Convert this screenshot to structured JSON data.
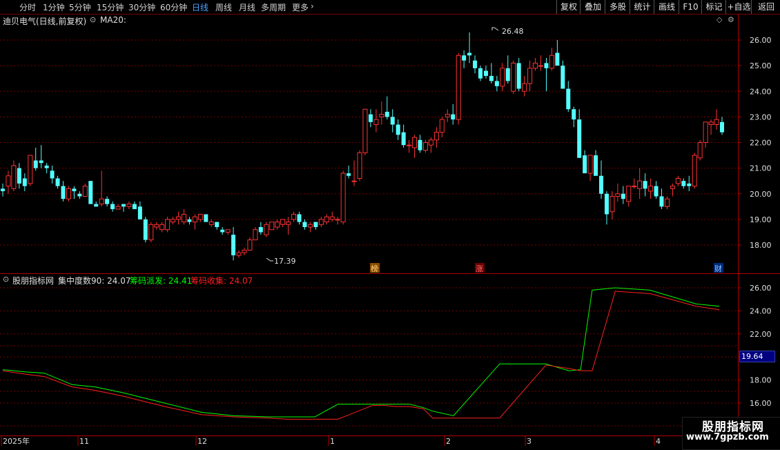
{
  "toolbar": {
    "periods": [
      "分时",
      "1分钟",
      "5分钟",
      "15分钟",
      "30分钟",
      "60分钟",
      "日线",
      "周线",
      "月线",
      "多周期",
      "更多"
    ],
    "active": "日线",
    "right_buttons": [
      "复权",
      "叠加",
      "多股",
      "统计",
      "画线",
      "F10",
      "标记",
      "+自选",
      "返回"
    ]
  },
  "main_header": {
    "stock": "迪贝电气(日线,前复权)",
    "ma": "MA20:"
  },
  "annotations": {
    "high": "26.48",
    "low": "17.39",
    "tag1": "榜",
    "tag2": "涨",
    "tag3": "财"
  },
  "indicator_header": {
    "name": "股朋指标网",
    "item1": "集中度数90: 24.07",
    "item2": "筹码派发: 24.41",
    "item3": "筹码收集: 24.07"
  },
  "value_box": "19.64",
  "time_axis": [
    "2025年",
    "11",
    "12",
    "1",
    "2",
    "3",
    "4"
  ],
  "watermark": {
    "line1": "股朋指标网",
    "line2": "www.7gpzb.com"
  },
  "colors": {
    "up": "#ff3333",
    "down": "#54ffff",
    "grid": "#7a0000",
    "green": "#00ff00",
    "red": "#ff2020"
  },
  "chart_data": [
    {
      "type": "candlestick",
      "price_ticks": [
        "26.00",
        "25.00",
        "24.00",
        "23.00",
        "22.00",
        "21.00",
        "20.00",
        "19.00",
        "18.00"
      ],
      "ylim": [
        17.0,
        26.8
      ],
      "candles": [
        [
          20.2,
          20.4,
          19.9,
          20.1
        ],
        [
          20.3,
          20.9,
          20.0,
          20.7
        ],
        [
          20.2,
          21.3,
          20.1,
          21.1
        ],
        [
          21.0,
          21.2,
          20.2,
          20.4
        ],
        [
          20.6,
          20.8,
          20.1,
          20.3
        ],
        [
          20.4,
          21.5,
          20.3,
          21.5
        ],
        [
          21.3,
          21.8,
          20.9,
          21.0
        ],
        [
          21.3,
          21.9,
          21.0,
          21.2
        ],
        [
          21.1,
          21.2,
          20.8,
          21.0
        ],
        [
          20.9,
          21.1,
          20.4,
          20.6
        ],
        [
          20.6,
          20.7,
          20.2,
          20.3
        ],
        [
          20.3,
          20.5,
          19.7,
          19.8
        ],
        [
          19.8,
          20.3,
          19.7,
          20.2
        ],
        [
          20.2,
          20.3,
          19.8,
          20.1
        ],
        [
          20.0,
          20.1,
          19.8,
          19.9
        ],
        [
          19.9,
          20.4,
          19.9,
          20.3
        ],
        [
          20.5,
          20.5,
          19.6,
          19.6
        ],
        [
          19.6,
          19.7,
          19.5,
          19.5
        ],
        [
          19.6,
          20.9,
          19.5,
          19.8
        ],
        [
          19.8,
          19.9,
          19.5,
          19.6
        ],
        [
          19.6,
          19.7,
          19.3,
          19.4
        ],
        [
          19.4,
          19.6,
          19.4,
          19.5
        ],
        [
          19.6,
          19.6,
          19.3,
          19.5
        ],
        [
          19.5,
          19.7,
          19.4,
          19.6
        ],
        [
          19.6,
          19.7,
          19.4,
          19.4
        ],
        [
          19.5,
          19.7,
          19.3,
          19.0
        ],
        [
          19.0,
          19.1,
          18.1,
          18.2
        ],
        [
          18.2,
          18.9,
          18.1,
          18.8
        ],
        [
          18.7,
          18.9,
          18.6,
          18.8
        ],
        [
          18.6,
          18.9,
          18.5,
          18.8
        ],
        [
          18.6,
          19.1,
          18.5,
          19.0
        ],
        [
          18.9,
          19.1,
          18.8,
          19.0
        ],
        [
          19.0,
          19.3,
          18.8,
          19.1
        ],
        [
          18.9,
          19.4,
          18.8,
          19.2
        ],
        [
          19.0,
          19.1,
          18.8,
          18.9
        ],
        [
          18.9,
          19.2,
          18.6,
          19.1
        ],
        [
          19.0,
          19.2,
          18.9,
          19.2
        ],
        [
          19.2,
          19.2,
          18.9,
          18.9
        ],
        [
          18.8,
          19.0,
          18.7,
          18.9
        ],
        [
          18.9,
          18.9,
          18.6,
          18.7
        ],
        [
          18.6,
          18.7,
          18.4,
          18.5
        ],
        [
          18.5,
          18.6,
          18.4,
          18.6
        ],
        [
          18.4,
          18.7,
          17.4,
          17.6
        ],
        [
          17.6,
          17.8,
          17.5,
          17.7
        ],
        [
          17.7,
          17.9,
          17.6,
          17.8
        ],
        [
          17.8,
          18.3,
          17.8,
          18.2
        ],
        [
          18.2,
          18.7,
          18.2,
          18.6
        ],
        [
          18.7,
          18.9,
          18.4,
          18.5
        ],
        [
          18.4,
          18.9,
          18.3,
          18.8
        ],
        [
          18.6,
          18.9,
          18.6,
          18.9
        ],
        [
          18.7,
          19.0,
          18.6,
          18.9
        ],
        [
          18.8,
          19.0,
          18.7,
          19.0
        ],
        [
          18.8,
          19.1,
          18.4,
          18.9
        ],
        [
          19.0,
          19.3,
          18.9,
          19.2
        ],
        [
          19.2,
          19.3,
          18.8,
          18.9
        ],
        [
          18.9,
          19.0,
          18.6,
          18.7
        ],
        [
          18.7,
          18.9,
          18.5,
          18.8
        ],
        [
          18.9,
          18.9,
          18.6,
          18.7
        ],
        [
          18.8,
          19.1,
          18.7,
          19.0
        ],
        [
          18.9,
          19.2,
          18.8,
          19.1
        ],
        [
          19.0,
          19.3,
          18.9,
          19.1
        ],
        [
          19.0,
          19.1,
          18.8,
          19.0
        ],
        [
          18.9,
          20.9,
          18.8,
          20.8
        ],
        [
          20.8,
          21.1,
          20.6,
          20.7
        ],
        [
          20.5,
          21.3,
          20.3,
          20.5
        ],
        [
          20.6,
          21.7,
          20.5,
          21.6
        ],
        [
          21.6,
          23.3,
          21.5,
          23.3
        ],
        [
          23.1,
          23.3,
          22.6,
          22.8
        ],
        [
          22.7,
          23.3,
          22.4,
          22.9
        ],
        [
          23.0,
          23.6,
          22.7,
          23.1
        ],
        [
          23.2,
          23.8,
          22.9,
          23.0
        ],
        [
          23.0,
          23.3,
          22.4,
          22.7
        ],
        [
          22.7,
          22.9,
          22.1,
          22.3
        ],
        [
          22.4,
          22.7,
          21.8,
          21.9
        ],
        [
          21.9,
          22.1,
          21.6,
          21.9
        ],
        [
          21.8,
          22.3,
          21.4,
          22.2
        ],
        [
          22.1,
          22.3,
          21.6,
          21.7
        ],
        [
          21.7,
          22.1,
          21.6,
          22.0
        ],
        [
          21.9,
          22.2,
          21.6,
          22.1
        ],
        [
          22.1,
          22.6,
          21.8,
          22.4
        ],
        [
          22.4,
          23.0,
          22.2,
          22.9
        ],
        [
          23.0,
          23.3,
          22.8,
          23.1
        ],
        [
          23.1,
          23.5,
          22.7,
          22.9
        ],
        [
          22.9,
          25.5,
          22.7,
          25.4
        ],
        [
          25.4,
          25.6,
          24.9,
          25.2
        ],
        [
          25.5,
          26.3,
          25.1,
          25.4
        ],
        [
          25.2,
          25.4,
          24.7,
          24.9
        ],
        [
          24.9,
          25.0,
          24.4,
          24.5
        ],
        [
          24.8,
          25.0,
          24.5,
          24.6
        ],
        [
          24.6,
          25.1,
          24.3,
          24.4
        ],
        [
          24.4,
          24.6,
          24.0,
          24.2
        ],
        [
          24.2,
          25.1,
          24.0,
          24.9
        ],
        [
          24.9,
          25.4,
          24.3,
          24.4
        ],
        [
          24.0,
          25.2,
          23.9,
          25.1
        ],
        [
          25.1,
          25.3,
          24.0,
          24.1
        ],
        [
          24.0,
          24.6,
          23.8,
          24.3
        ],
        [
          24.3,
          25.2,
          24.0,
          24.9
        ],
        [
          24.9,
          25.3,
          24.8,
          25.1
        ],
        [
          25.0,
          25.4,
          24.8,
          25.0
        ],
        [
          25.1,
          25.3,
          24.0,
          24.9
        ],
        [
          24.9,
          25.7,
          24.8,
          25.4
        ],
        [
          25.5,
          26.0,
          25.0,
          25.0
        ],
        [
          25.0,
          25.2,
          24.1,
          24.1
        ],
        [
          24.1,
          24.4,
          23.2,
          23.3
        ],
        [
          23.3,
          23.4,
          22.6,
          22.9
        ],
        [
          22.9,
          23.3,
          21.4,
          21.4
        ],
        [
          21.5,
          21.7,
          20.8,
          20.8
        ],
        [
          20.8,
          21.5,
          20.5,
          21.5
        ],
        [
          21.5,
          21.7,
          20.8,
          20.7
        ],
        [
          20.7,
          21.3,
          19.8,
          20.0
        ],
        [
          20.0,
          20.1,
          18.8,
          19.2
        ],
        [
          19.3,
          20.1,
          19.0,
          19.9
        ],
        [
          19.9,
          20.4,
          19.7,
          20.0
        ],
        [
          20.0,
          20.3,
          19.6,
          19.8
        ],
        [
          19.7,
          20.3,
          19.5,
          20.3
        ],
        [
          20.3,
          20.6,
          20.2,
          20.3
        ],
        [
          20.2,
          21.0,
          19.8,
          20.5
        ],
        [
          20.5,
          20.8,
          19.9,
          20.2
        ],
        [
          20.1,
          20.6,
          19.8,
          20.3
        ],
        [
          20.3,
          20.5,
          19.8,
          19.9
        ],
        [
          19.9,
          20.2,
          19.4,
          19.5
        ],
        [
          19.5,
          19.9,
          19.4,
          19.8
        ],
        [
          20.2,
          20.4,
          19.9,
          20.3
        ],
        [
          20.4,
          20.7,
          20.3,
          20.6
        ],
        [
          20.5,
          20.6,
          20.2,
          20.3
        ],
        [
          20.4,
          20.7,
          20.1,
          20.3
        ],
        [
          20.3,
          21.6,
          20.2,
          21.5
        ],
        [
          21.4,
          22.1,
          21.3,
          22.0
        ],
        [
          22.0,
          22.8,
          21.8,
          22.8
        ],
        [
          22.7,
          22.9,
          22.3,
          22.8
        ],
        [
          22.7,
          23.3,
          22.5,
          22.9
        ],
        [
          22.8,
          23.0,
          22.3,
          22.4
        ]
      ]
    },
    {
      "type": "line",
      "title": "集中度数90",
      "value_ticks": [
        "26.00",
        "24.00",
        "22.00",
        "20.00",
        "18.00",
        "16.00"
      ],
      "ylim": [
        14.5,
        27.0
      ],
      "series": [
        {
          "name": "筹码派发",
          "color": "#00ff00",
          "x": [
            0,
            10,
            18,
            30,
            40,
            52,
            70,
            86,
            100,
            115,
            123,
            135,
            145,
            160,
            165,
            170,
            176,
            182,
            186,
            195,
            215,
            235,
            245,
            250,
            255,
            265,
            280,
            300,
            310
          ],
          "values": [
            18.9,
            18.7,
            18.6,
            17.6,
            17.4,
            16.9,
            16.0,
            15.2,
            14.9,
            14.8,
            14.8,
            14.8,
            15.9,
            15.9,
            15.9,
            15.9,
            15.9,
            15.6,
            15.3,
            14.9,
            19.4,
            19.4,
            18.8,
            18.9,
            25.8,
            26.0,
            25.8,
            24.6,
            24.4
          ]
        },
        {
          "name": "筹码收集",
          "color": "#ff2020",
          "x": [
            0,
            10,
            18,
            30,
            40,
            52,
            70,
            86,
            100,
            115,
            123,
            135,
            145,
            160,
            165,
            170,
            176,
            182,
            186,
            195,
            215,
            235,
            245,
            250,
            255,
            265,
            280,
            300,
            310
          ],
          "values": [
            18.8,
            18.5,
            18.3,
            17.4,
            17.1,
            16.6,
            15.7,
            15.0,
            14.8,
            14.7,
            14.6,
            14.6,
            14.6,
            15.8,
            15.8,
            15.7,
            15.7,
            15.5,
            14.7,
            14.7,
            14.7,
            19.3,
            19.0,
            18.8,
            18.8,
            25.7,
            25.5,
            24.4,
            24.1
          ]
        }
      ]
    }
  ]
}
